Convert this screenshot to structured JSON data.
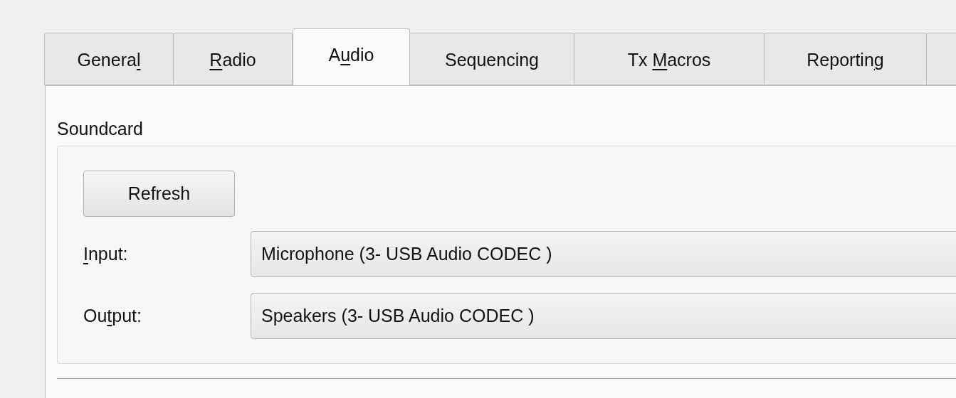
{
  "tabs": [
    {
      "label": [
        {
          "text": "Genera",
          "underlined": false
        },
        {
          "text": "l",
          "underlined": true
        }
      ],
      "selected": false
    },
    {
      "label": [
        {
          "text": "R",
          "underlined": true
        },
        {
          "text": "adio",
          "underlined": false
        }
      ],
      "selected": false
    },
    {
      "label": [
        {
          "text": "A",
          "underlined": false
        },
        {
          "text": "u",
          "underlined": true
        },
        {
          "text": "dio",
          "underlined": false
        }
      ],
      "selected": true
    },
    {
      "label": [
        {
          "text": "Sequencing",
          "underlined": false
        }
      ],
      "selected": false
    },
    {
      "label": [
        {
          "text": "Tx ",
          "underlined": false
        },
        {
          "text": "M",
          "underlined": true
        },
        {
          "text": "acros",
          "underlined": false
        }
      ],
      "selected": false
    },
    {
      "label": [
        {
          "text": "Reportin",
          "underlined": false
        },
        {
          "text": "g",
          "underlined": true
        }
      ],
      "selected": false
    }
  ],
  "soundcard": {
    "title": "Soundcard",
    "refresh_button": "Refresh",
    "fields": [
      {
        "label": [
          {
            "text": "I",
            "underlined": true
          },
          {
            "text": "nput:",
            "underlined": false
          }
        ],
        "value": "Microphone (3- USB Audio CODEC )"
      },
      {
        "label": [
          {
            "text": "Ou",
            "underlined": false
          },
          {
            "text": "t",
            "underlined": true
          },
          {
            "text": "put:",
            "underlined": false
          }
        ],
        "value": "Speakers (3- USB Audio CODEC )"
      }
    ]
  }
}
